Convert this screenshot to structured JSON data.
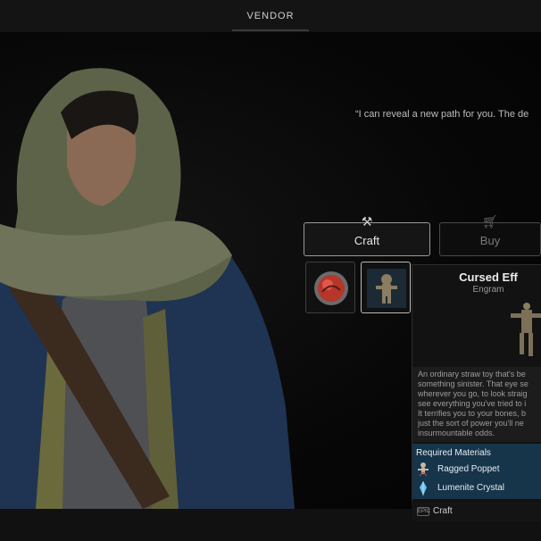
{
  "header": {
    "title": "VENDOR"
  },
  "dialogue": {
    "quote": "“I can reveal a new path for you. The de"
  },
  "tabs": [
    {
      "label": "Craft",
      "icon": "tools-icon",
      "active": true
    },
    {
      "label": "Buy",
      "icon": "cart-icon",
      "active": false
    }
  ],
  "slots": [
    {
      "icon": "red-orb-engram-icon",
      "selected": false
    },
    {
      "icon": "voodoo-doll-icon",
      "selected": true
    }
  ],
  "item": {
    "name": "Cursed Eff",
    "type": "Engram",
    "description_lines": [
      "An ordinary straw toy that's be",
      "something sinister. That eye se",
      "wherever you go, to look straig",
      "see everything you've tried to i",
      "It terrifies you to your bones, b",
      "just the sort of power you'll ne",
      "insurmountable odds."
    ],
    "materials_title": "Required Materials",
    "materials": [
      {
        "label": "Ragged Poppet",
        "icon": "poppet-icon"
      },
      {
        "label": "Lumenite Crystal",
        "icon": "crystal-icon"
      }
    ]
  },
  "action": {
    "key": "EPIC",
    "label": "Craft"
  },
  "colors": {
    "materials_bg": "#16344a",
    "accent_red": "#c0392b"
  }
}
